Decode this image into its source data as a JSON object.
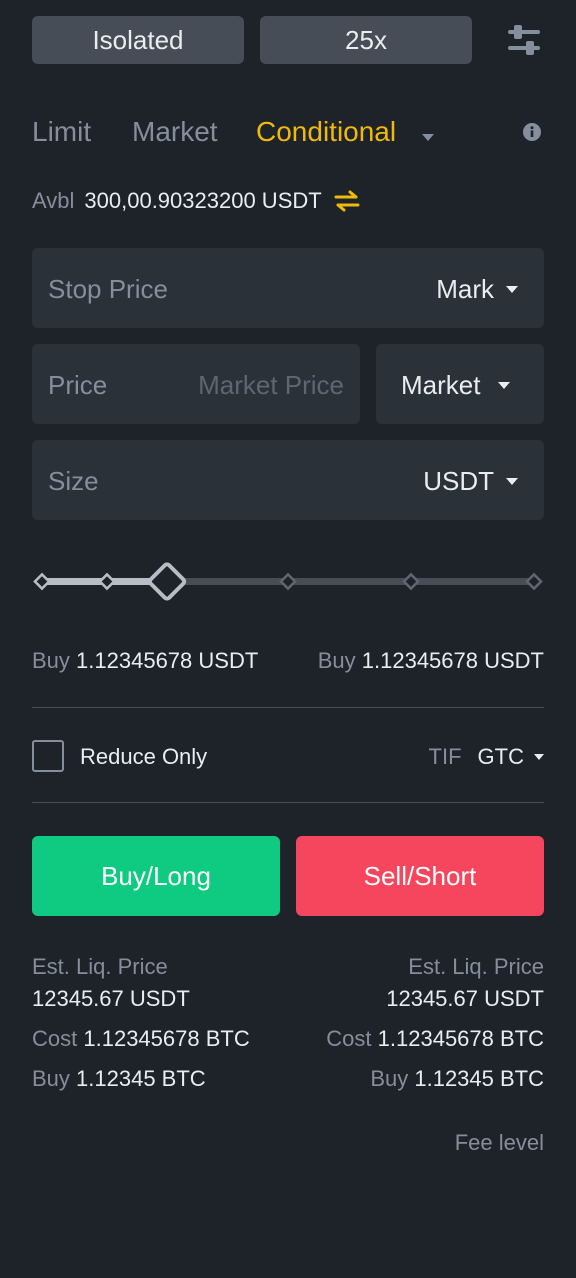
{
  "header": {
    "margin_mode": "Isolated",
    "leverage": "25x"
  },
  "tabs": [
    {
      "label": "Limit"
    },
    {
      "label": "Market"
    },
    {
      "label": "Conditional"
    }
  ],
  "available": {
    "label": "Avbl",
    "value": "300,00.90323200 USDT"
  },
  "stop_price": {
    "placeholder": "Stop Price",
    "trigger_type": "Mark"
  },
  "price": {
    "label": "Price",
    "placeholder": "Market Price",
    "order_type": "Market"
  },
  "size": {
    "placeholder": "Size",
    "unit": "USDT"
  },
  "slider": {
    "percent": 25
  },
  "max_buy": {
    "left_label": "Buy",
    "left_value": "1.12345678 USDT",
    "right_label": "Buy",
    "right_value": "1.12345678 USDT"
  },
  "options": {
    "reduce_only_label": "Reduce Only",
    "reduce_only_checked": false,
    "tif_label": "TIF",
    "tif_value": "GTC"
  },
  "actions": {
    "buy_label": "Buy/Long",
    "sell_label": "Sell/Short",
    "buy_color": "#0ecb81",
    "sell_color": "#f6465d"
  },
  "summary": {
    "left": {
      "liq_label": "Est. Liq. Price",
      "liq_value": "12345.67 USDT",
      "cost_label": "Cost",
      "cost_value": "1.12345678 BTC",
      "buy_label": "Buy",
      "buy_value": "1.12345 BTC"
    },
    "right": {
      "liq_label": "Est. Liq. Price",
      "liq_value": "12345.67 USDT",
      "cost_label": "Cost",
      "cost_value": "1.12345678 BTC",
      "buy_label": "Buy",
      "buy_value": "1.12345 BTC"
    }
  },
  "fee_level_label": "Fee level",
  "colors": {
    "accent": "#f0b90b",
    "background": "#1e2329",
    "panel": "#2b3139"
  }
}
